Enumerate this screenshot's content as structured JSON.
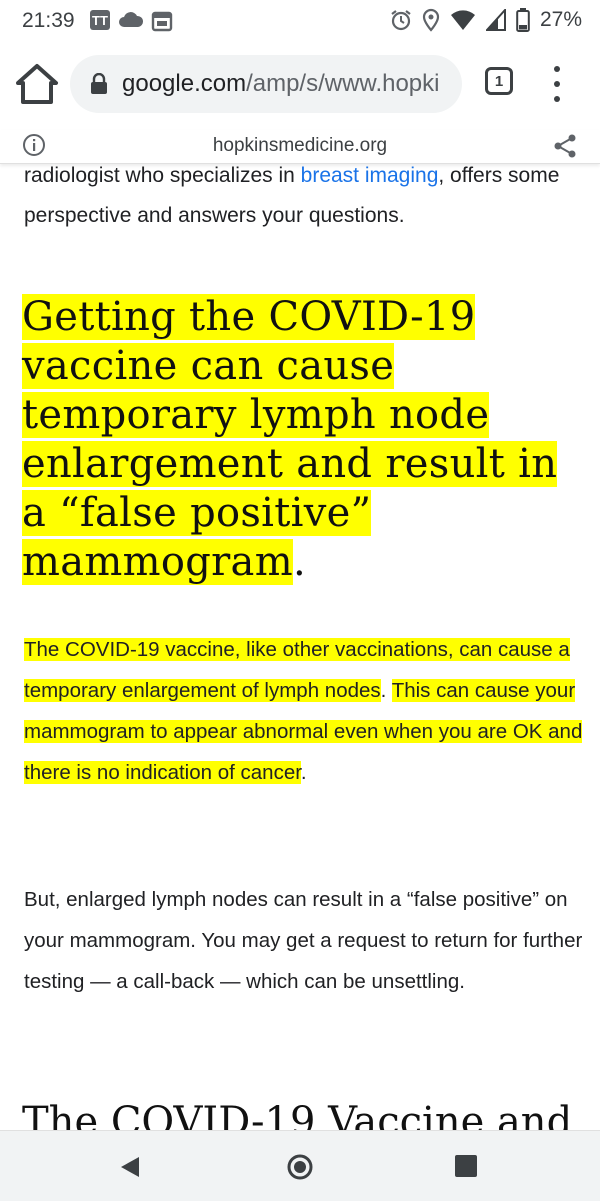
{
  "status_bar": {
    "time": "21:39",
    "notif_tt": "TT",
    "battery_percent": "27%",
    "icons": [
      "tt-app-icon",
      "cloud-icon",
      "calendar-icon",
      "alarm-icon",
      "location-icon",
      "wifi-icon",
      "signal-icon",
      "battery-icon"
    ]
  },
  "browser": {
    "url_main": "google.com",
    "url_path": "/amp/s/www.hopki",
    "tab_count": "1"
  },
  "amp_header": {
    "domain": "hopkinsmedicine.org"
  },
  "article": {
    "intro_before_link": "radiologist who specializes in ",
    "intro_link": "breast imaging",
    "intro_after_link": ", offers some perspective and answers your questions.",
    "heading": "Getting the COVID-19 vaccine can cause temporary lymph node enlargement and result in a “false positive” mammogram",
    "heading_punct": ".",
    "para1_highlight_a": "The COVID-19 vaccine, like other vaccinations, can cause a temporary enlargement of lymph nodes",
    "para1_sep": ". ",
    "para1_highlight_b": "This can cause your mammogram to appear abnormal even when you are OK and there is no indication of cancer",
    "para1_end": ".",
    "para2": "But, enlarged lymph nodes can result in a “false positive” on your mammogram. You may get a request to return for further testing — a call-back — which can be unsettling.",
    "next_heading": "The COVID-19 Vaccine and"
  },
  "colors": {
    "highlight": "#ffff00",
    "link": "#1a73e8"
  }
}
